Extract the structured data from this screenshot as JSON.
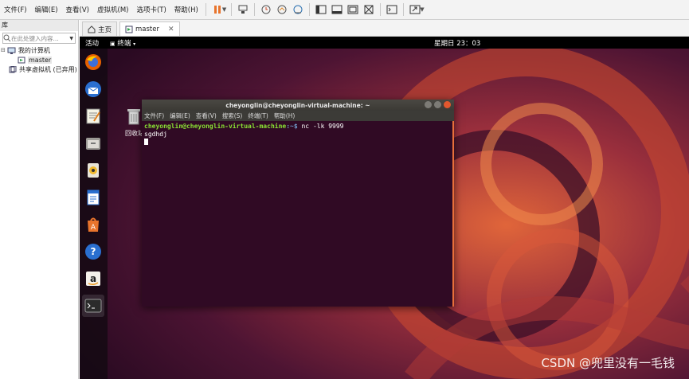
{
  "menubar": {
    "items": [
      "文件(F)",
      "编辑(E)",
      "查看(V)",
      "虚拟机(M)",
      "选项卡(T)",
      "帮助(H)"
    ]
  },
  "sidebar": {
    "header": "库",
    "search_placeholder": "在此处键入内容...",
    "tree": {
      "root": "我的计算机",
      "vm": "master",
      "shared": "共享虚拟机 (已弃用)"
    }
  },
  "tabs": {
    "home": "主页",
    "vm": "master"
  },
  "guest": {
    "activities": "活动",
    "app_menu": "终端",
    "clock": "星期日 23：03",
    "trash_label": "回收站"
  },
  "terminal": {
    "title": "cheyonglin@cheyonglin-virtual-machine: ~",
    "menu": [
      "文件(F)",
      "编辑(E)",
      "查看(V)",
      "搜索(S)",
      "终端(T)",
      "帮助(H)"
    ],
    "prompt_user": "cheyonglin@cheyonglin-virtual-machine",
    "prompt_path": ":~$",
    "command": " nc -lk 9999",
    "output": "sgdhdj"
  },
  "watermark": "CSDN @兜里没有一毛钱",
  "colors": {
    "terminal_bg": "#300a24",
    "prompt_green": "#8ae234",
    "accent_orange": "#e86f3a"
  }
}
